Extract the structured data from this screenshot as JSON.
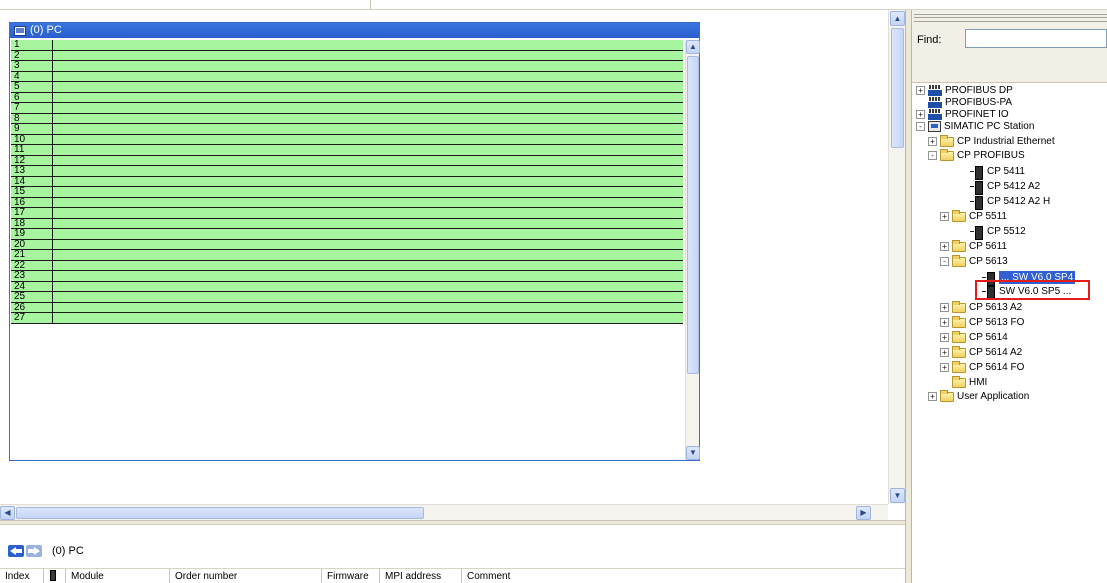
{
  "station_window": {
    "title": "(0) PC",
    "slots": [
      "1",
      "2",
      "3",
      "4",
      "5",
      "6",
      "7",
      "8",
      "9",
      "10",
      "11",
      "12",
      "13",
      "14",
      "15",
      "16",
      "17",
      "18",
      "19",
      "20",
      "21",
      "22",
      "23",
      "24",
      "25",
      "26",
      "27"
    ],
    "slot_color": "#a8f5a0"
  },
  "navigation": {
    "station_label": "(0)  PC"
  },
  "detail_table": {
    "columns": [
      "Index",
      "Module",
      "Order number",
      "Firmware",
      "MPI address",
      "Comment"
    ]
  },
  "catalog": {
    "find_label": "Find:",
    "find_value": "",
    "tree": [
      {
        "label": "PROFIBUS DP",
        "expander": "+",
        "icon": "bus-icon"
      },
      {
        "label": "PROFIBUS-PA",
        "expander": "",
        "icon": "bus-icon"
      },
      {
        "label": "PROFINET IO",
        "expander": "+",
        "icon": "bus-icon"
      },
      {
        "label": "SIMATIC PC Station",
        "expander": "-",
        "icon": "pc-station-icon"
      },
      {
        "label": "CP Industrial Ethernet",
        "expander": "+",
        "icon": "folder-icon"
      },
      {
        "label": "CP PROFIBUS",
        "expander": "-",
        "icon": "folder-icon"
      },
      {
        "label": "CP 5411",
        "expander": "",
        "icon": "module-icon"
      },
      {
        "label": "CP 5412 A2",
        "expander": "",
        "icon": "module-icon"
      },
      {
        "label": "CP 5412 A2 H",
        "expander": "",
        "icon": "module-icon"
      },
      {
        "label": "CP 5511",
        "expander": "+",
        "icon": "folder-icon"
      },
      {
        "label": "CP 5512",
        "expander": "",
        "icon": "module-icon"
      },
      {
        "label": "CP 5611",
        "expander": "+",
        "icon": "folder-icon"
      },
      {
        "label": "CP 5613",
        "expander": "-",
        "icon": "folder-icon"
      },
      {
        "label": "... SW V6.0 SP4",
        "expander": "",
        "icon": "module-icon",
        "selected": true
      },
      {
        "label": "SW V6.0 SP5 ...",
        "expander": "",
        "icon": "module-icon"
      },
      {
        "label": "CP 5613 A2",
        "expander": "+",
        "icon": "folder-icon"
      },
      {
        "label": "CP 5613 FO",
        "expander": "+",
        "icon": "folder-icon"
      },
      {
        "label": "CP 5614",
        "expander": "+",
        "icon": "folder-icon"
      },
      {
        "label": "CP 5614 A2",
        "expander": "+",
        "icon": "folder-icon"
      },
      {
        "label": "CP 5614 FO",
        "expander": "+",
        "icon": "folder-icon"
      },
      {
        "label": "HMI",
        "expander": "",
        "icon": "folder-icon"
      },
      {
        "label": "User Application",
        "expander": "+",
        "icon": "folder-icon"
      }
    ]
  },
  "colors": {
    "titlebar": "#2a5fcc",
    "selection": "#2f5fd0",
    "highlight_box": "#e31b1b"
  }
}
